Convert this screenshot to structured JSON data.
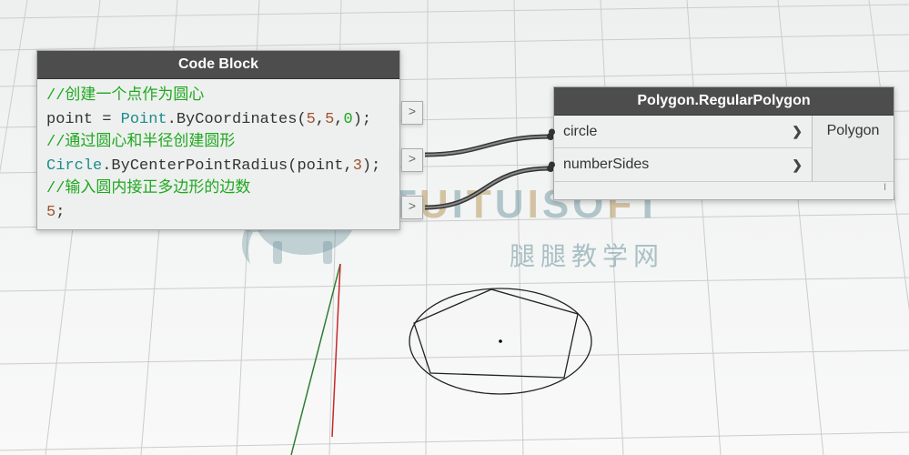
{
  "codeBlock": {
    "title": "Code Block",
    "lines": {
      "c1": "//创建一个点作为圆心",
      "p_var": "point",
      "p_eq": " = ",
      "p_type": "Point",
      "p_dot": ".",
      "p_method": "ByCoordinates",
      "p_open": "(",
      "p_n1": "5",
      "p_comma1": ",",
      "p_n2": "5",
      "p_comma2": ",",
      "p_n3": "0",
      "p_close": ")",
      "p_semi": ";",
      "c2": "//通过圆心和半径创建圆形",
      "cr_type": "Circle",
      "cr_dot": ".",
      "cr_method": "ByCenterPointRadius",
      "cr_open": "(",
      "cr_arg1": "point",
      "cr_comma": ",",
      "cr_n": "3",
      "cr_close": ")",
      "cr_semi": ";",
      "c3": "//输入圆内接正多边形的边数",
      "s_n": "5",
      "s_semi": ";"
    },
    "port_symbol": ">"
  },
  "polygonNode": {
    "title": "Polygon.RegularPolygon",
    "inputs": [
      {
        "label": "circle",
        "chevron": "❯"
      },
      {
        "label": "numberSides",
        "chevron": "❯"
      }
    ],
    "output": "Polygon",
    "footer": "I"
  },
  "watermark": {
    "text_parts": [
      "T",
      "U",
      "I",
      "T",
      "U",
      "I",
      "S",
      "O",
      "F",
      "T"
    ],
    "sub": "腿腿教学网"
  }
}
